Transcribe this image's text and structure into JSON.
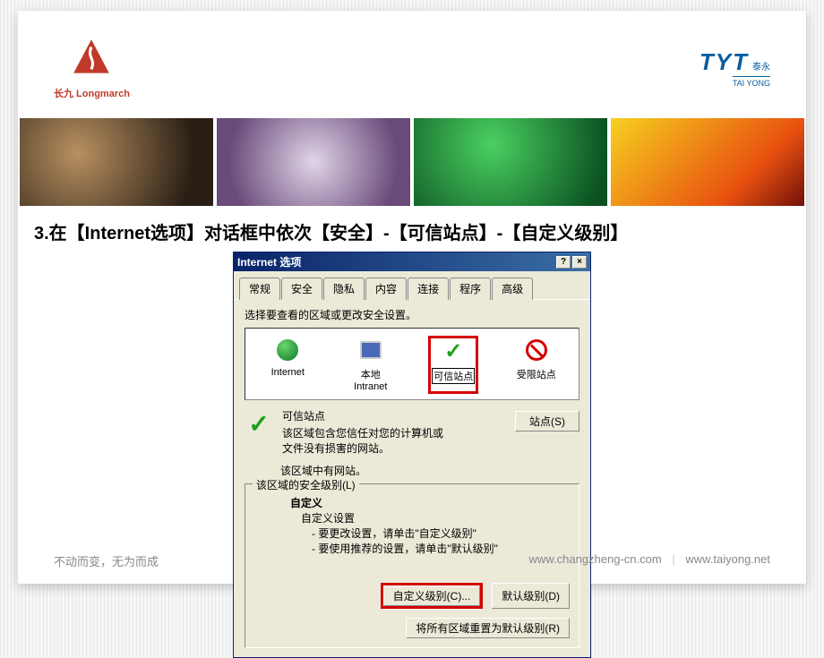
{
  "logos": {
    "left_text": "长九 Longmarch",
    "right_main": "TYT",
    "right_sub1": "泰永",
    "right_sub2": "TAI YONG"
  },
  "heading": "3.在【Internet选项】对话框中依次【安全】-【可信站点】-【自定义级别】",
  "dialog": {
    "title": "Internet 选项",
    "help_btn": "?",
    "close_btn": "×",
    "tabs": [
      "常规",
      "安全",
      "隐私",
      "内容",
      "连接",
      "程序",
      "高级"
    ],
    "instruction": "选择要查看的区域或更改安全设置。",
    "zones": {
      "internet": "Internet",
      "intranet": "本地 Intranet",
      "trusted": "可信站点",
      "restricted": "受限站点"
    },
    "trusted_section": {
      "title": "可信站点",
      "desc1": "该区域包含您信任对您的计算机或",
      "desc2": "文件没有损害的网站。",
      "sites_btn": "站点(S)"
    },
    "zone_status": "该区域中有网站。",
    "fieldset_legend": "该区域的安全级别(L)",
    "custom": {
      "title": "自定义",
      "line1": "自定义设置",
      "line2": "- 要更改设置，请单击\"自定义级别\"",
      "line3": "- 要使用推荐的设置，请单击\"默认级别\""
    },
    "custom_level_btn": "自定义级别(C)...",
    "default_level_btn": "默认级别(D)",
    "reset_btn": "将所有区域重置为默认级别(R)"
  },
  "footer": {
    "left": "不动而变，无为而成",
    "url1": "www.changzheng-cn.com",
    "url2": "www.taiyong.net"
  }
}
